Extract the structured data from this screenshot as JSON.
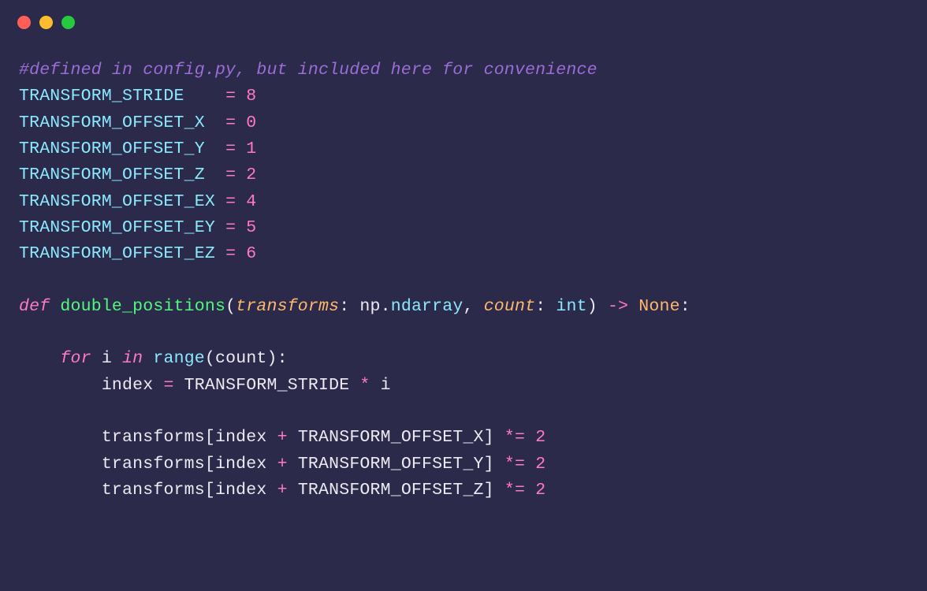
{
  "comment": "#defined in config.py, but included here for convenience",
  "consts": [
    {
      "name": "TRANSFORM_STRIDE",
      "pad": "   ",
      "val": "8"
    },
    {
      "name": "TRANSFORM_OFFSET_X",
      "pad": " ",
      "val": "0"
    },
    {
      "name": "TRANSFORM_OFFSET_Y",
      "pad": " ",
      "val": "1"
    },
    {
      "name": "TRANSFORM_OFFSET_Z",
      "pad": " ",
      "val": "2"
    },
    {
      "name": "TRANSFORM_OFFSET_EX",
      "pad": "",
      "val": "4"
    },
    {
      "name": "TRANSFORM_OFFSET_EY",
      "pad": "",
      "val": "5"
    },
    {
      "name": "TRANSFORM_OFFSET_EZ",
      "pad": "",
      "val": "6"
    }
  ],
  "def_kw": "def",
  "func_name": "double_positions",
  "param1_name": "transforms",
  "param1_module": "np",
  "param1_type": "ndarray",
  "param2_name": "count",
  "param2_type": "int",
  "arrow": "->",
  "return_type": "None",
  "for_kw": "for",
  "loop_var": "i",
  "in_kw": "in",
  "range_fn": "range",
  "range_arg": "count",
  "index_var": "index",
  "stride_const": "TRANSFORM_STRIDE",
  "star": "*",
  "i_var": "i",
  "arr_var": "transforms",
  "plus": "+",
  "offsets": [
    "TRANSFORM_OFFSET_X",
    "TRANSFORM_OFFSET_Y",
    "TRANSFORM_OFFSET_Z"
  ],
  "muleq": "*=",
  "two": "2",
  "eq": "=",
  "colon": ":",
  "dot": ".",
  "comma": ",",
  "lparen": "(",
  "rparen": ")",
  "lbrack": "[",
  "rbrack": "]"
}
